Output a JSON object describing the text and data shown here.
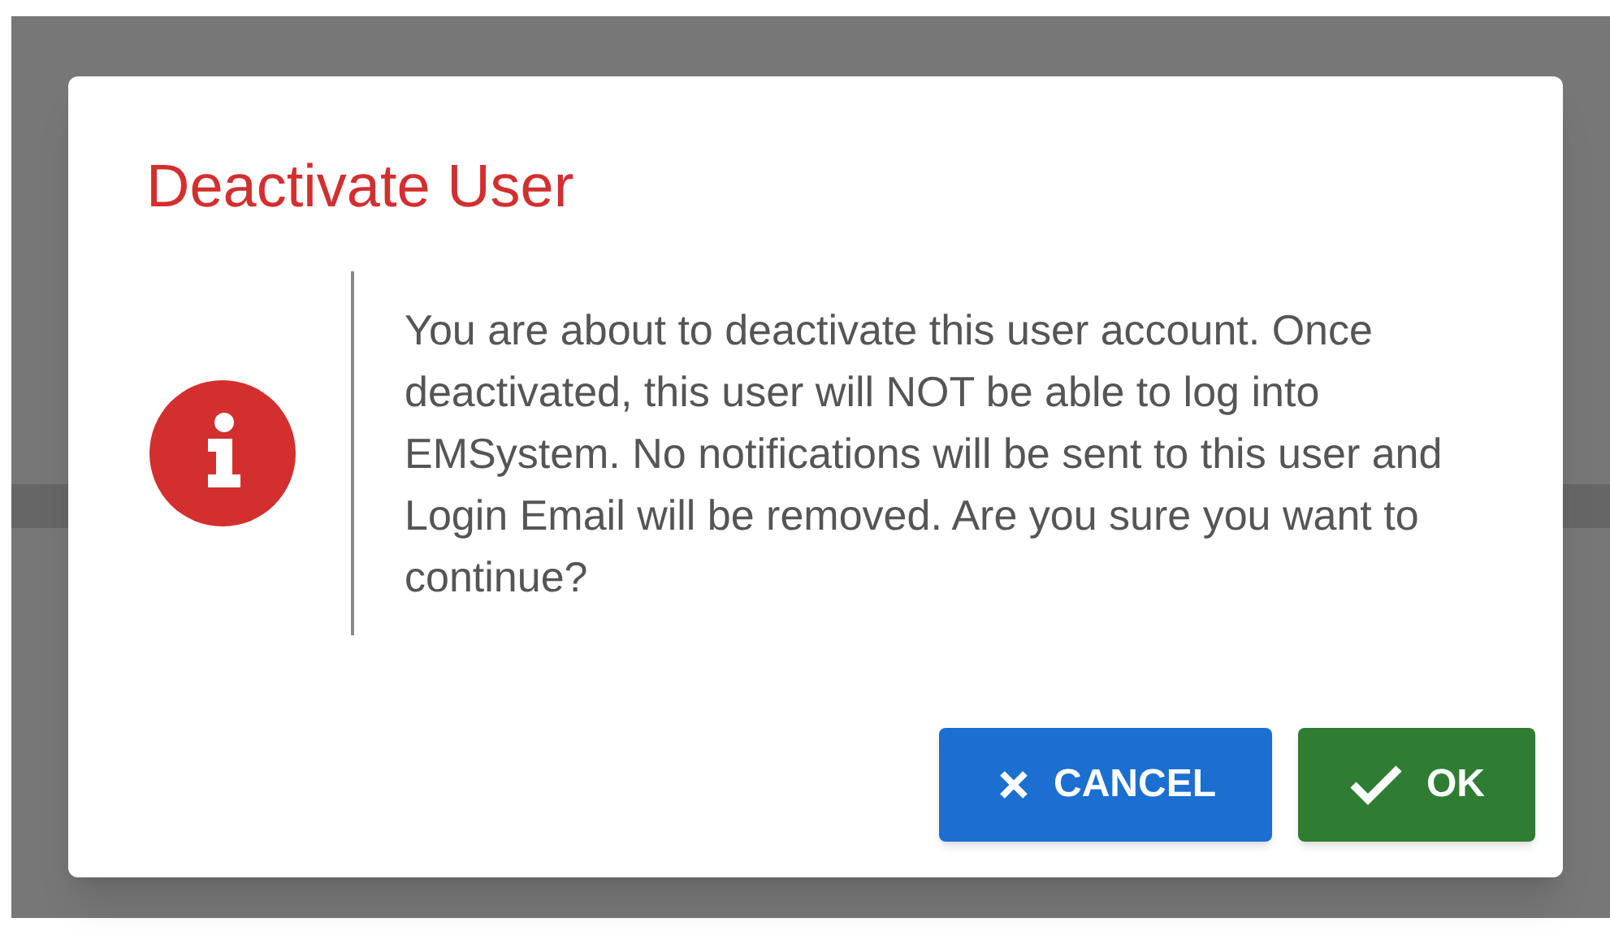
{
  "dialog": {
    "title": "Deactivate User",
    "message": "You are about to deactivate this user account. Once deactivated, this user will NOT be able to log into EMSystem. No notifications will be sent to this user and Login Email will be removed. Are you sure you want to continue?",
    "buttons": [
      {
        "kind": "cancel",
        "label": "CANCEL"
      },
      {
        "kind": "ok",
        "label": "OK"
      }
    ]
  }
}
